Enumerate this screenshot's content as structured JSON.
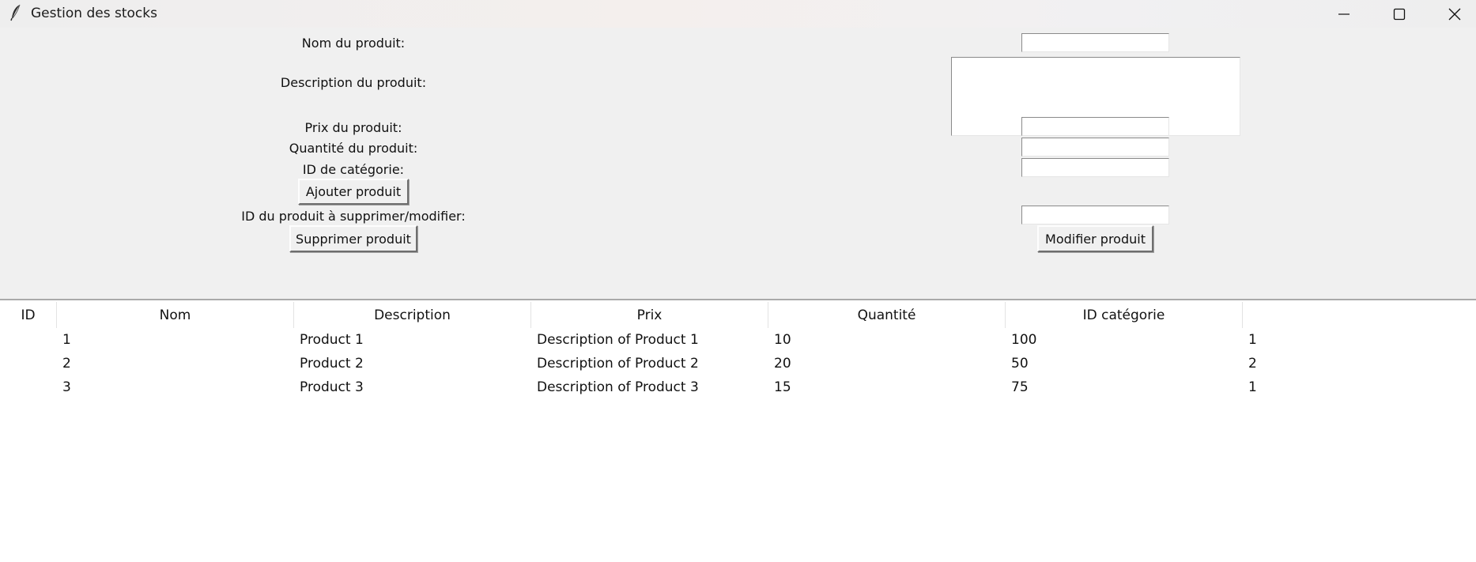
{
  "window": {
    "title": "Gestion des stocks",
    "icon": "feather-icon"
  },
  "form": {
    "name_label": "Nom du produit:",
    "name_value": "",
    "description_label": "Description du produit:",
    "description_value": "",
    "price_label": "Prix du produit:",
    "price_value": "",
    "quantity_label": "Quantité du produit:",
    "quantity_value": "",
    "category_label": "ID de catégorie:",
    "category_value": "",
    "add_button": "Ajouter produit",
    "target_id_label": "ID du produit à supprimer/modifier:",
    "target_id_value": "",
    "delete_button": "Supprimer produit",
    "modify_button": "Modifier produit"
  },
  "table": {
    "columns": [
      "ID",
      "Nom",
      "Description",
      "Prix",
      "Quantité",
      "ID catégorie"
    ],
    "rows": [
      [
        "1",
        "Product 1",
        "Description of Product 1",
        "10",
        "100",
        "1"
      ],
      [
        "2",
        "Product 2",
        "Description of Product 2",
        "20",
        "50",
        "2"
      ],
      [
        "3",
        "Product 3",
        "Description of Product 3",
        "15",
        "75",
        "1"
      ]
    ]
  }
}
